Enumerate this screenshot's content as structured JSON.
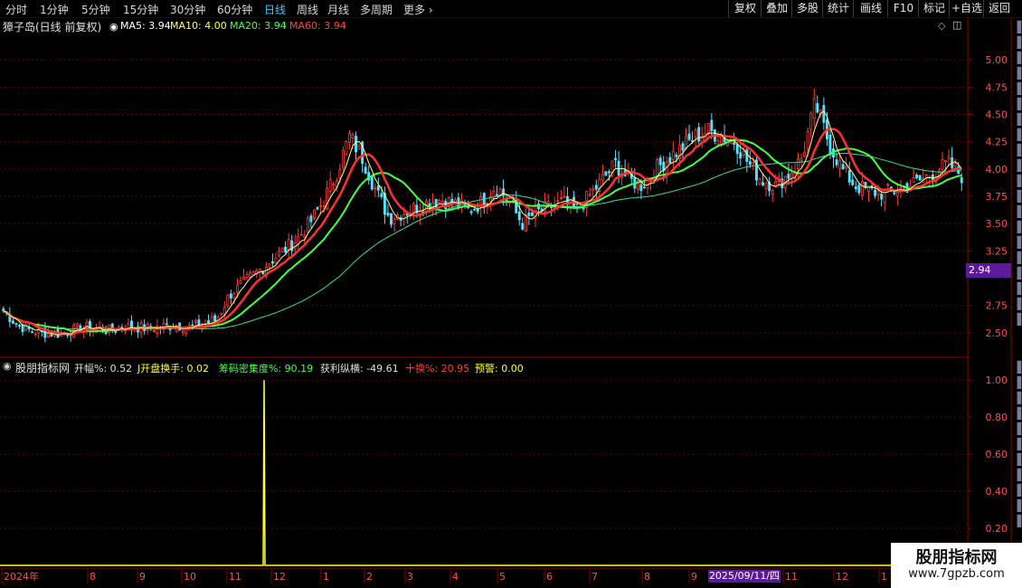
{
  "toolbar": {
    "periods": [
      "分时",
      "1分钟",
      "5分钟",
      "15分钟",
      "30分钟",
      "60分钟",
      "日线",
      "周线",
      "月线",
      "多周期",
      "更多"
    ],
    "active_period": "日线",
    "buttons": [
      "复权",
      "叠加",
      "多股",
      "统计",
      "画线",
      "F10",
      "标记",
      "+自选",
      "返回"
    ]
  },
  "main_header": {
    "title": "獐子岛(日线 前复权)",
    "ma5": "MA5: 3.94",
    "ma10": "MA10: 4.00",
    "ma20": "MA20: 3.94",
    "ma60": "MA60: 3.94"
  },
  "indicator_header": {
    "name": "股朋指标网",
    "kaifu": "开幅%: 0.52",
    "jkphs": "J开盘换手: 0.02",
    "cmjzd": "筹码密集度%: 90.19",
    "hlzh": "获利纵横: -49.61",
    "shihuan": "十换%: 20.95",
    "yujing": "预警: 0.00"
  },
  "current_price_badge": "2.94",
  "cursor_date_badge": "2025/09/11/四",
  "date_axis": [
    "2024年",
    "8",
    "9",
    "10",
    "11",
    "12",
    "1",
    "2",
    "3",
    "4",
    "5",
    "6",
    "7",
    "8",
    "9",
    "1",
    "11",
    "12",
    "1"
  ],
  "watermark": {
    "title": "股朋指标网",
    "url": "www.7gpzb.com"
  },
  "colors": {
    "up": "#ff3c3c",
    "down": "#54e0ff",
    "ma5": "#ffffff",
    "ma10": "#ffff55",
    "ma20": "#44ff44",
    "ma60": "#ff3030",
    "indicator": "#ffff30",
    "grid": "#6a0000"
  },
  "chart_data": [
    {
      "type": "candlestick",
      "title": "獐子岛(日线 前复权)",
      "yticks": [
        5.0,
        4.75,
        4.5,
        4.25,
        4.0,
        3.75,
        3.5,
        3.25,
        2.75,
        2.5
      ],
      "ylim": [
        2.3,
        5.25
      ],
      "series_close_approx": [
        2.7,
        2.58,
        2.52,
        2.5,
        2.49,
        2.52,
        2.55,
        2.54,
        2.52,
        2.56,
        2.55,
        2.54,
        2.56,
        2.57,
        2.55,
        2.58,
        2.62,
        2.85,
        2.95,
        3.05,
        3.15,
        3.25,
        3.35,
        3.5,
        3.7,
        3.95,
        4.3,
        4.1,
        3.8,
        3.55,
        3.6,
        3.65,
        3.7,
        3.72,
        3.68,
        3.62,
        3.7,
        3.85,
        3.7,
        3.5,
        3.6,
        3.65,
        3.7,
        3.62,
        3.75,
        3.9,
        4.05,
        3.9,
        3.85,
        4.0,
        4.1,
        4.2,
        4.3,
        4.35,
        4.3,
        4.25,
        4.05,
        3.9,
        3.85,
        3.95,
        4.1,
        4.6,
        4.25,
        4.0,
        3.85,
        3.8,
        3.78,
        3.8,
        3.85,
        3.9,
        3.98,
        4.05,
        3.94
      ]
    },
    {
      "type": "line",
      "title": "股朋指标网",
      "yticks": [
        1.0,
        0.8,
        0.6,
        0.4,
        0.2
      ],
      "ylim": [
        0,
        1.05
      ],
      "spike": {
        "index_fraction": 0.292,
        "value": 1.0
      }
    }
  ]
}
